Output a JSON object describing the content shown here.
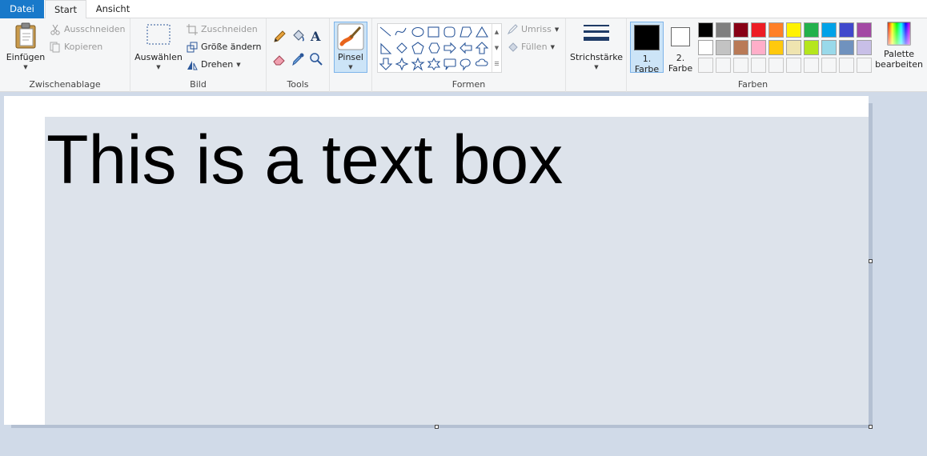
{
  "tabs": [
    {
      "label": "Datei",
      "active": false
    },
    {
      "label": "Start",
      "active": true
    },
    {
      "label": "Ansicht",
      "active": false
    }
  ],
  "groups": {
    "clipboard": {
      "label": "Zwischenablage",
      "paste": "Einfügen",
      "cut": "Ausschneiden",
      "copy": "Kopieren"
    },
    "image": {
      "label": "Bild",
      "select": "Auswählen",
      "crop": "Zuschneiden",
      "resize": "Größe ändern",
      "rotate": "Drehen"
    },
    "tools": {
      "label": "Tools"
    },
    "brushes": {
      "label": "Pinsel"
    },
    "shapes": {
      "label": "Formen",
      "outline": "Umriss",
      "fill": "Füllen"
    },
    "size": {
      "label": "Strichstärke"
    },
    "colors": {
      "label": "Farben",
      "color1_line1": "1.",
      "color1_line2": "Farbe",
      "color2_line1": "2.",
      "color2_line2": "Farbe",
      "edit_line1": "Palette",
      "edit_line2": "bearbeiten",
      "color1": "#000000",
      "color2": "#ffffff",
      "palette_row1": [
        "#000000",
        "#7f7f7f",
        "#880015",
        "#ed1c24",
        "#ff7f27",
        "#fff200",
        "#22b14c",
        "#00a2e8",
        "#3f48cc",
        "#a349a4"
      ],
      "palette_row2": [
        "#ffffff",
        "#c3c3c3",
        "#b97a57",
        "#ffaec9",
        "#ffc90e",
        "#efe4b0",
        "#b5e61d",
        "#99d9ea",
        "#7092be",
        "#c8bfe7"
      ]
    }
  },
  "canvas": {
    "text": "This is a text box"
  },
  "accent": "#1979ca"
}
